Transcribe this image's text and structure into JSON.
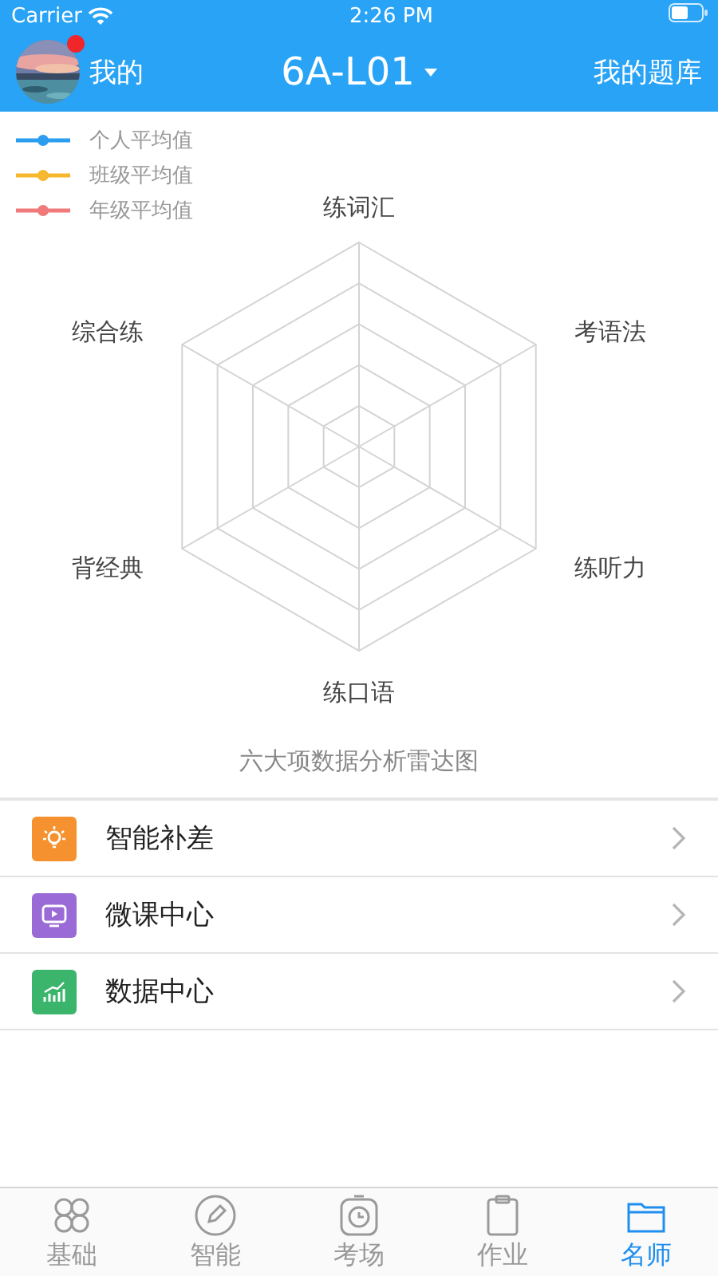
{
  "status_bar": {
    "carrier": "Carrier",
    "time": "2:26 PM"
  },
  "nav": {
    "left_label": "我的",
    "has_badge": true,
    "title": "6A-L01",
    "right_label": "我的题库"
  },
  "legend": [
    {
      "label": "个人平均值",
      "color": "#2b9ef0"
    },
    {
      "label": "班级平均值",
      "color": "#f5b82e"
    },
    {
      "label": "年级平均值",
      "color": "#f07a7a"
    }
  ],
  "radar": {
    "axes": [
      "练词汇",
      "考语法",
      "练听力",
      "练口语",
      "背经典",
      "综合练"
    ],
    "caption": "六大项数据分析雷达图"
  },
  "menu": [
    {
      "label": "智能补差",
      "color": "#f5922f",
      "kind": "bulb"
    },
    {
      "label": "微课中心",
      "color": "#9a6bd6",
      "kind": "video"
    },
    {
      "label": "数据中心",
      "color": "#3cb56c",
      "kind": "chart"
    }
  ],
  "tabs": [
    {
      "label": "基础",
      "selected": false,
      "kind": "petals"
    },
    {
      "label": "智能",
      "selected": false,
      "kind": "pencil"
    },
    {
      "label": "考场",
      "selected": false,
      "kind": "timer"
    },
    {
      "label": "作业",
      "selected": false,
      "kind": "clipboard"
    },
    {
      "label": "名师",
      "selected": true,
      "kind": "folder"
    }
  ]
}
